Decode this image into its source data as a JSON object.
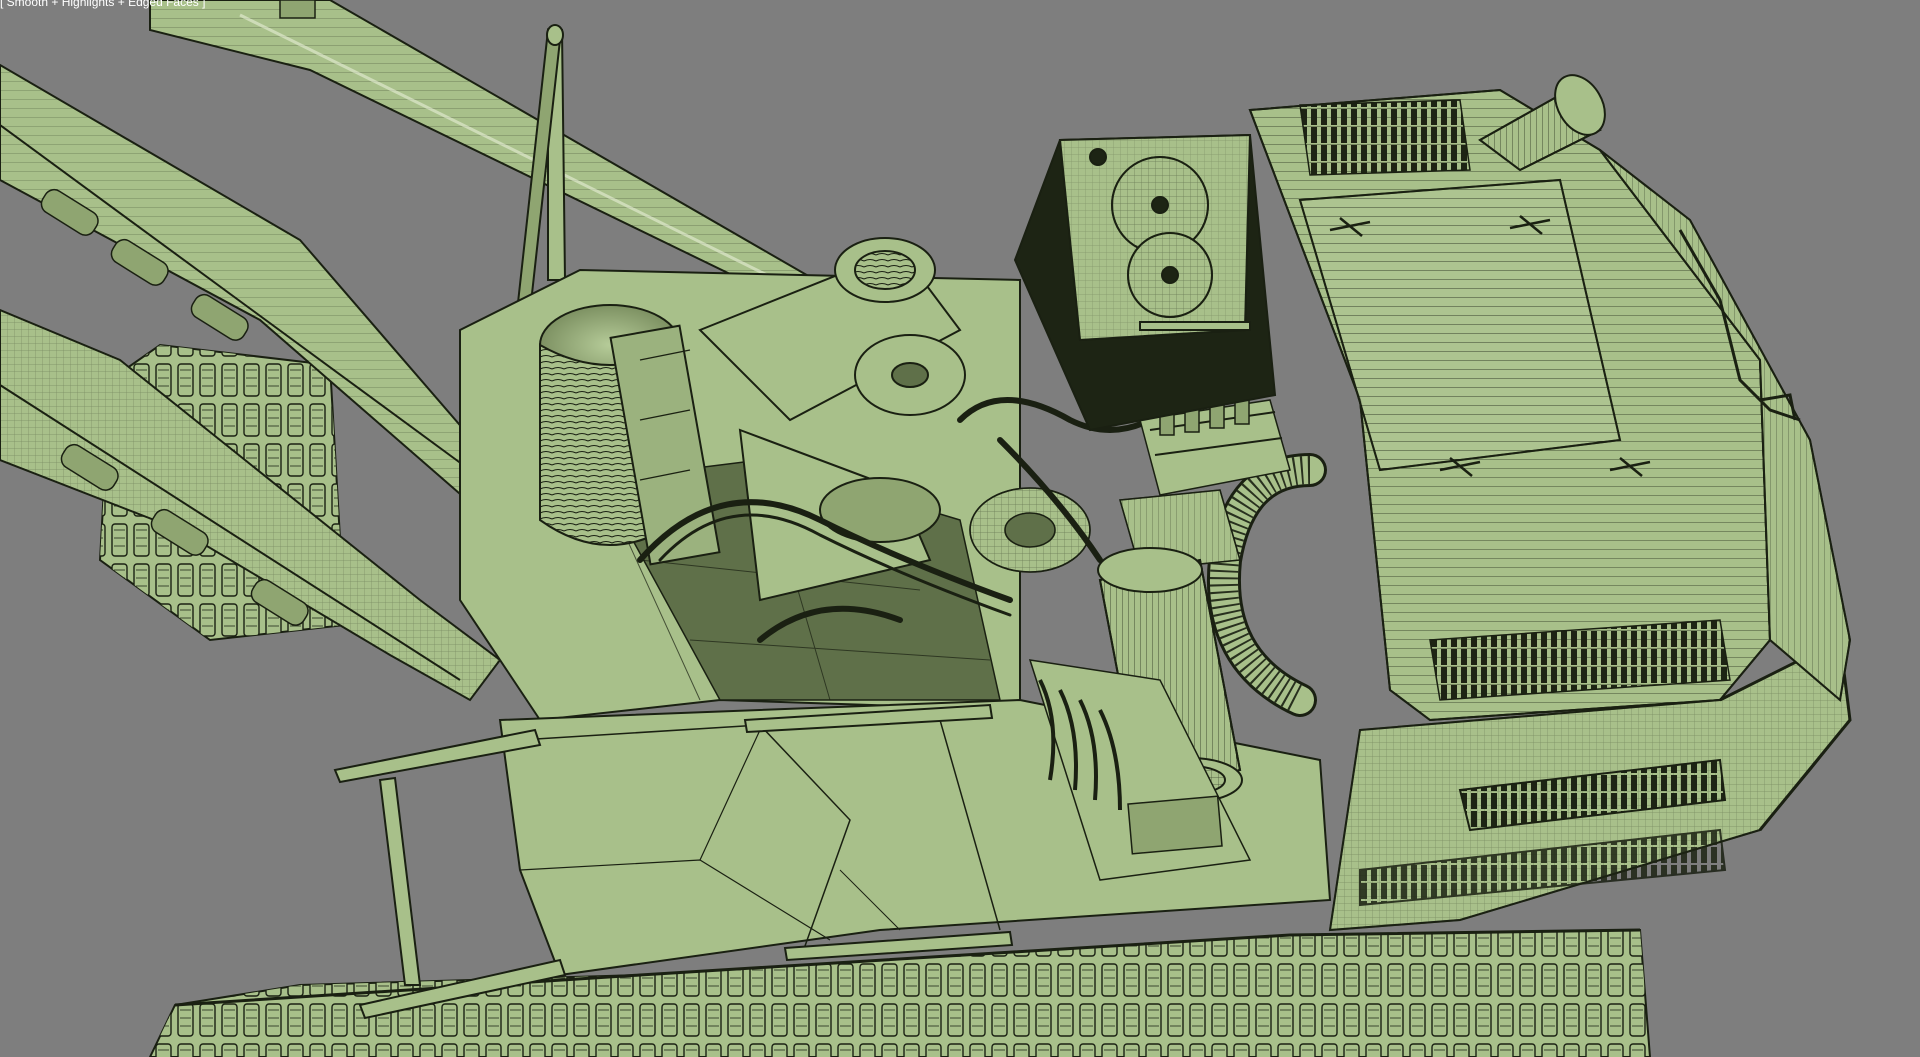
{
  "viewport": {
    "label": "[ Smooth + Highlights + Edged Faces ]",
    "background_color": "#7e7e7e",
    "model_color": "#a8c08a",
    "model_shadow_color": "#5f7049",
    "wire_color": "#1a2012",
    "subject": "crawler crane upper structure, wireframe on shaded"
  }
}
